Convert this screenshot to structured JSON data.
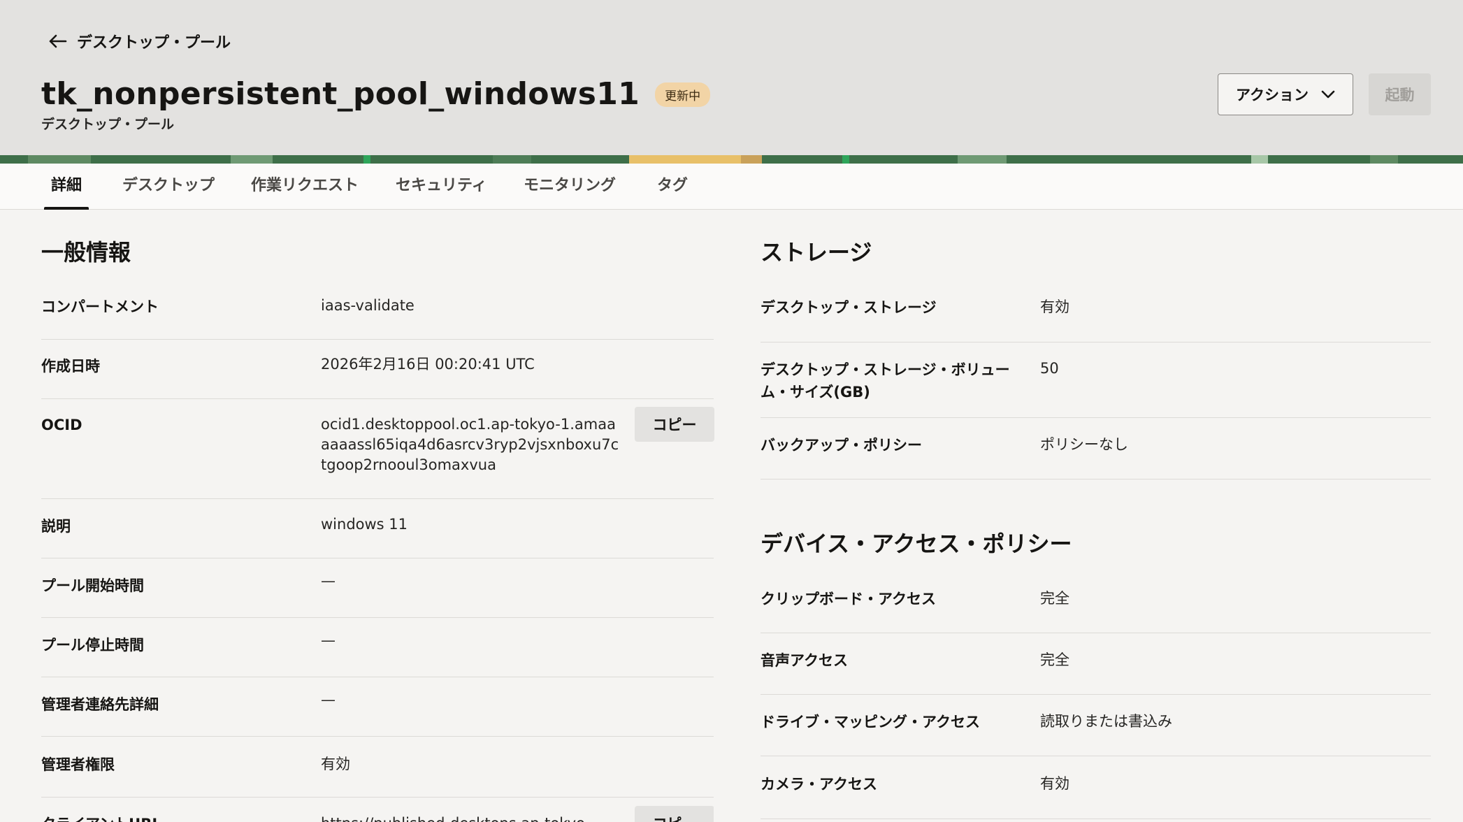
{
  "header": {
    "back_label": "デスクトップ・プール",
    "title": "tk_nonpersistent_pool_windows11",
    "status": "更新中",
    "subtitle": "デスクトップ・プール",
    "actions_label": "アクション",
    "start_label": "起動"
  },
  "tabs": [
    {
      "label": "詳細"
    },
    {
      "label": "デスクトップ"
    },
    {
      "label": "作業リクエスト"
    },
    {
      "label": "セキュリティ"
    },
    {
      "label": "モニタリング"
    },
    {
      "label": "タグ"
    }
  ],
  "general": {
    "title": "一般情報",
    "copy_label": "コピー",
    "rows": [
      {
        "label": "コンパートメント",
        "value": "iaas-validate"
      },
      {
        "label": "作成日時",
        "value": "2026年2月16日 00:20:41 UTC"
      },
      {
        "label": "OCID",
        "value": "ocid1.desktoppool.oc1.ap-tokyo-1.amaaaaaassl65iqa4d6asrcv3ryp2vjsxnboxu7ctgoop2rnooul3omaxvua"
      },
      {
        "label": "説明",
        "value": "windows 11"
      },
      {
        "label": "プール開始時間",
        "value": "—"
      },
      {
        "label": "プール停止時間",
        "value": "—"
      },
      {
        "label": "管理者連絡先詳細",
        "value": "—"
      },
      {
        "label": "管理者権限",
        "value": "有効"
      },
      {
        "label": "クライアントURL",
        "value": "https://published-desktops.ap-tokyo-"
      }
    ]
  },
  "storage": {
    "title": "ストレージ",
    "rows": [
      {
        "label": "デスクトップ・ストレージ",
        "value": "有効"
      },
      {
        "label": "デスクトップ・ストレージ・ボリューム・サイズ(GB)",
        "value": "50"
      },
      {
        "label": "バックアップ・ポリシー",
        "value": "ポリシーなし"
      }
    ]
  },
  "device_policy": {
    "title": "デバイス・アクセス・ポリシー",
    "rows": [
      {
        "label": "クリップボード・アクセス",
        "value": "完全"
      },
      {
        "label": "音声アクセス",
        "value": "完全"
      },
      {
        "label": "ドライブ・マッピング・アクセス",
        "value": "読取りまたは書込み"
      },
      {
        "label": "カメラ・アクセス",
        "value": "有効"
      }
    ]
  }
}
